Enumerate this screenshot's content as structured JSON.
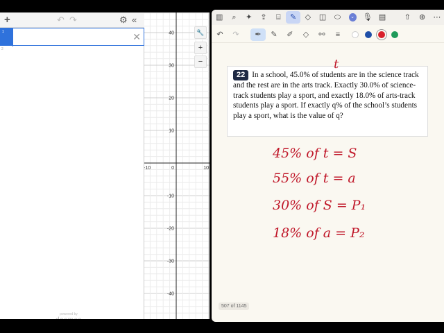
{
  "desmos": {
    "toolbar": {
      "add_label": "+",
      "undo_label": "↶",
      "redo_label": "↷",
      "settings_label": "⚙",
      "collapse_label": "«"
    },
    "expressions": [
      {
        "index": "1",
        "value": ""
      },
      {
        "index": "2",
        "value": ""
      }
    ],
    "close_label": "✕",
    "powered_small": "powered by",
    "powered_logo": "desmos",
    "graph_tools": {
      "wrench_label": "🔧",
      "zoom_in_label": "+",
      "zoom_out_label": "−"
    },
    "y_ticks": [
      "40",
      "30",
      "20",
      "10",
      "-10",
      "-20",
      "-30",
      "-40"
    ],
    "x_ticks": [
      "-10",
      "0",
      "10"
    ]
  },
  "notes": {
    "question_number": "22",
    "question_text": "In a school, 45.0% of students are in the science track and the rest are in the arts track. Exactly 30.0% of science-track students play a sport, and exactly 18.0% of arts-track students play a sport. If exactly q% of the school’s students play a sport, what is the value of q?",
    "page_counter": "507 of 1145",
    "handwriting": {
      "top_letter": "t",
      "line1": "45% of t = S",
      "line2": "55% of t = a",
      "line3": "30% of S = P₁",
      "line4": "18% of a = P₂"
    },
    "colors": {
      "ink": "#c0182a",
      "swatch_blue": "#1f4fa8",
      "swatch_red": "#d8202a",
      "swatch_green": "#1e9a5a"
    }
  }
}
